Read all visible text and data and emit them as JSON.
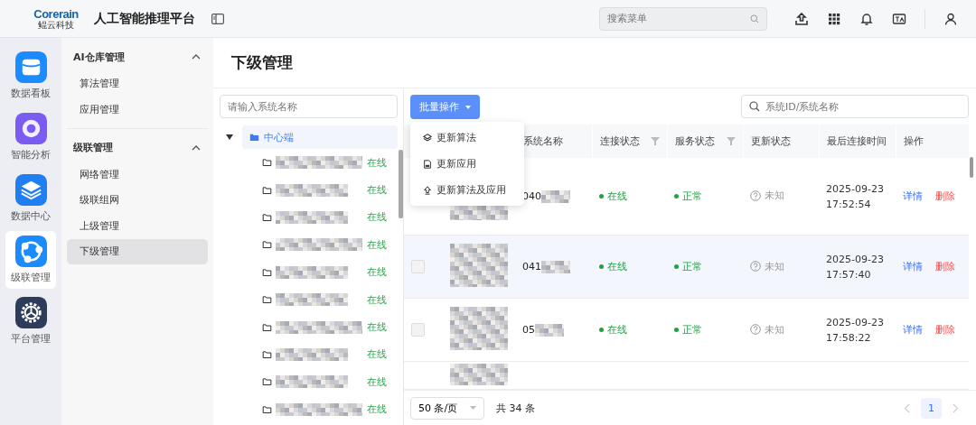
{
  "header": {
    "logo": {
      "name": "Corerain",
      "subtitle": "鲲云科技"
    },
    "title": "人工智能推理平台",
    "search": {
      "placeholder": "搜索菜单"
    }
  },
  "rail": [
    {
      "label": "数据看板",
      "kind": "dashboard",
      "selected": false
    },
    {
      "label": "智能分析",
      "kind": "analysis",
      "selected": false
    },
    {
      "label": "数据中心",
      "kind": "data",
      "selected": false
    },
    {
      "label": "级联管理",
      "kind": "cascade",
      "selected": true
    },
    {
      "label": "平台管理",
      "kind": "platform",
      "selected": false
    }
  ],
  "submenu": [
    {
      "title": "AI仓库管理",
      "expanded": true,
      "items": [
        {
          "label": "算法管理",
          "selected": false
        },
        {
          "label": "应用管理",
          "selected": false
        }
      ]
    },
    {
      "title": "级联管理",
      "expanded": true,
      "items": [
        {
          "label": "网络管理",
          "selected": false
        },
        {
          "label": "级联组网",
          "selected": false
        },
        {
          "label": "上级管理",
          "selected": false
        },
        {
          "label": "下级管理",
          "selected": true
        }
      ]
    }
  ],
  "page_title": "下级管理",
  "tree": {
    "search_placeholder": "请输入系统名称",
    "root": {
      "label": "中心端",
      "expanded": true,
      "selected": true,
      "children": [
        {
          "status": "在线"
        },
        {
          "status": "在线"
        },
        {
          "status": "在线"
        },
        {
          "status": "在线"
        },
        {
          "status": "在线"
        },
        {
          "status": "在线"
        },
        {
          "status": "在线"
        },
        {
          "status": "在线"
        },
        {
          "status": "在线"
        },
        {
          "status": "在线"
        }
      ]
    }
  },
  "toolbar": {
    "batch_button": "批量操作",
    "search_placeholder": "系统ID/系统名称"
  },
  "menu": [
    {
      "label": "更新算法",
      "kind": "algorithm"
    },
    {
      "label": "更新应用",
      "kind": "app"
    },
    {
      "label": "更新算法及应用",
      "kind": "both"
    }
  ],
  "table": {
    "columns": [
      "系统名称",
      "连接状态",
      "服务状态",
      "更新状态",
      "最后连接时间",
      "操作"
    ],
    "rows": [
      {
        "name": "040",
        "connection": "在线",
        "service": "正常",
        "update": "未知",
        "time": "2025-09-23 17:52:54",
        "actions": [
          "详情",
          "删除"
        ],
        "hovered": false
      },
      {
        "name": "041",
        "connection": "在线",
        "service": "正常",
        "update": "未知",
        "time": "2025-09-23 17:57:40",
        "actions": [
          "详情",
          "删除"
        ],
        "hovered": true,
        "checked": false
      },
      {
        "name": "05",
        "connection": "在线",
        "service": "正常",
        "update": "未知",
        "time": "2025-09-23 17:58:22",
        "actions": [
          "详情",
          "删除"
        ],
        "hovered": false,
        "checked": false
      }
    ]
  },
  "pagination": {
    "page_size": "50 条/页",
    "total": "共 34 条",
    "pages": [
      {
        "label": "1",
        "selected": true
      }
    ]
  }
}
